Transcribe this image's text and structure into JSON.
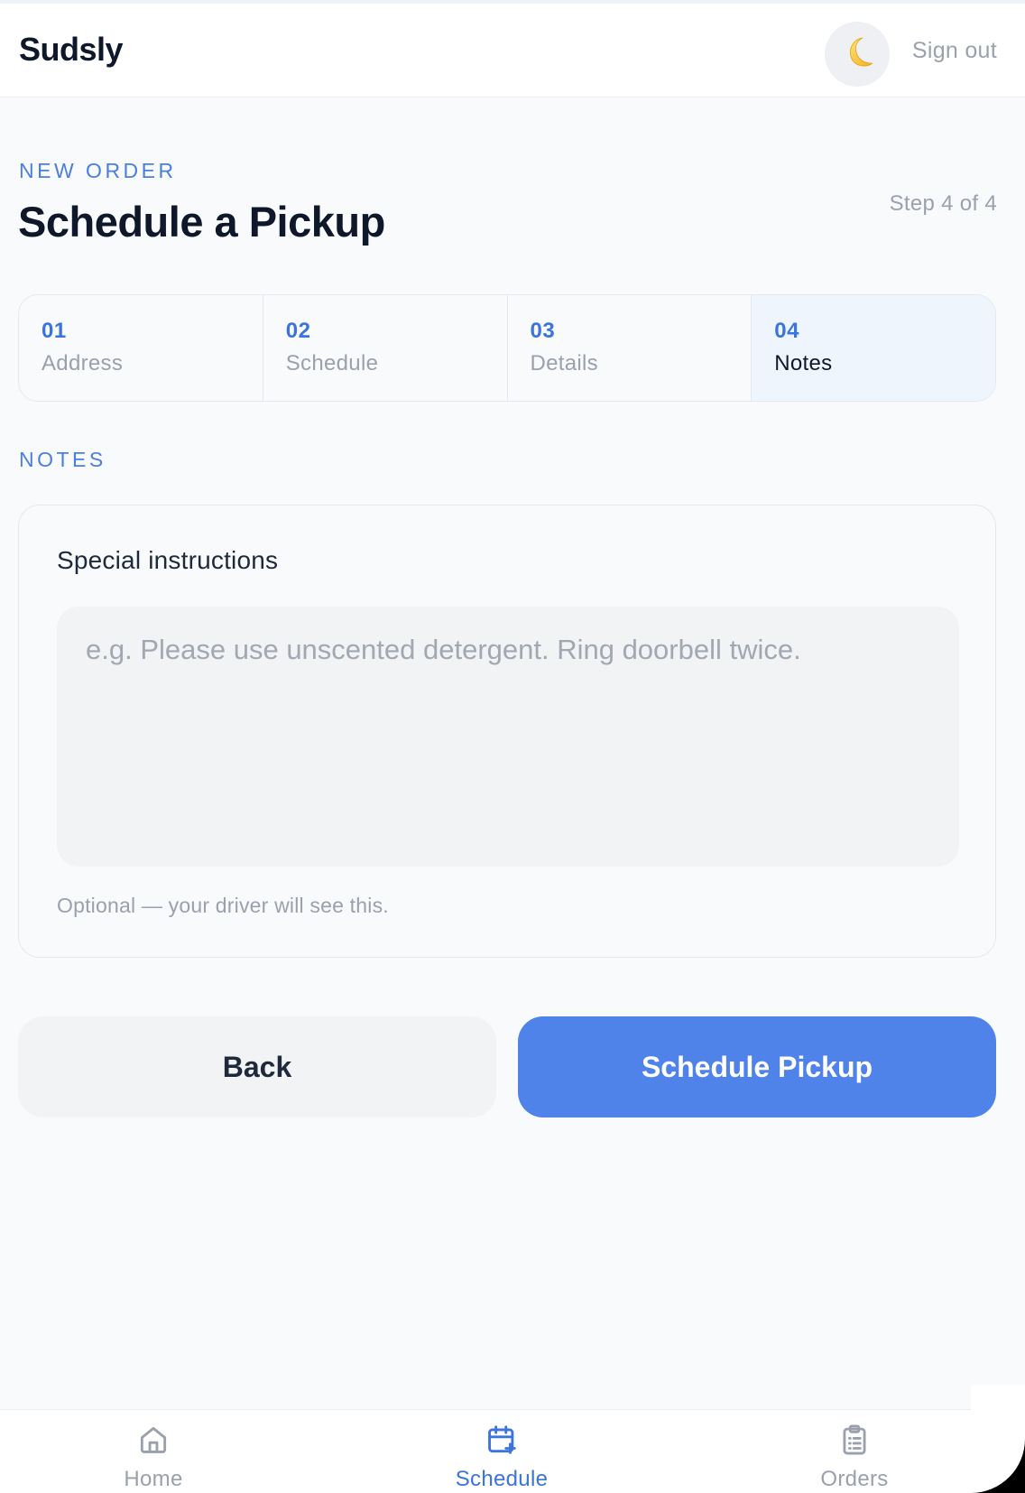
{
  "header": {
    "app_title": "Sudsly",
    "theme_toggle_icon": "moon-icon",
    "sign_out_label": "Sign out"
  },
  "page": {
    "eyebrow": "NEW ORDER",
    "title": "Schedule a Pickup",
    "step_counter": "Step 4 of 4"
  },
  "stepper": {
    "current_step": 4,
    "steps": [
      {
        "number": "01",
        "label": "Address"
      },
      {
        "number": "02",
        "label": "Schedule"
      },
      {
        "number": "03",
        "label": "Details"
      },
      {
        "number": "04",
        "label": "Notes"
      }
    ]
  },
  "notes": {
    "section_label": "NOTES",
    "field_label": "Special instructions",
    "value": "",
    "placeholder": "e.g. Please use unscented detergent. Ring doorbell twice.",
    "hint": "Optional — your driver will see this."
  },
  "actions": {
    "back_label": "Back",
    "submit_label": "Schedule Pickup"
  },
  "bottom_nav": {
    "active": "Schedule",
    "items": [
      {
        "label": "Home",
        "icon": "home-icon"
      },
      {
        "label": "Schedule",
        "icon": "calendar-plus-icon"
      },
      {
        "label": "Orders",
        "icon": "clipboard-list-icon"
      }
    ]
  },
  "colors": {
    "accent": "#4f83ea",
    "accent_text": "#3b74dc",
    "title": "#0f172a",
    "muted": "#9aa1ad",
    "background": "#f8fafc"
  }
}
